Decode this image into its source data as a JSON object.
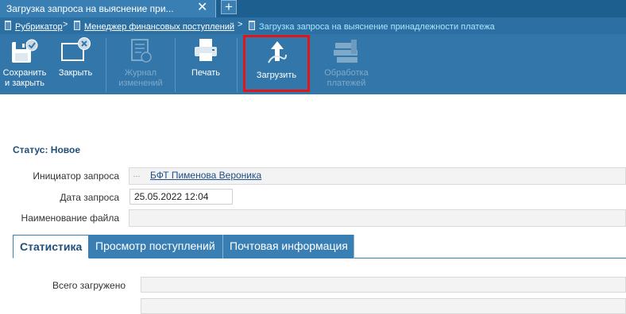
{
  "window_tab": {
    "title": "Загрузка запроса на выяснение при...",
    "close": "✕",
    "new_tab": "+"
  },
  "breadcrumb": [
    {
      "label": "Рубрикатор"
    },
    {
      "label": "Менеджер финансовых поступлений"
    },
    {
      "label": "Загрузка запроса на выяснение принадлежности платежа"
    }
  ],
  "breadcrumb_sep": ">",
  "toolbar": {
    "save_close": {
      "line1": "Сохранить",
      "line2": "и закрыть"
    },
    "close": "Закрыть",
    "journal": {
      "line1": "Журнал",
      "line2": "изменений"
    },
    "print": "Печать",
    "upload": "Загрузить",
    "process": {
      "line1": "Обработка",
      "line2": "платежей"
    }
  },
  "form": {
    "status": "Статус: Новое",
    "initiator_label": "Инициатор запроса",
    "initiator_value": "БФТ Пименова Вероника",
    "initiator_dots": "...",
    "date_label": "Дата запроса",
    "date_value": "25.05.2022 12:04",
    "filename_label": "Наименование файла",
    "filename_value": ""
  },
  "tabs": [
    {
      "label": "Статистика",
      "active": true
    },
    {
      "label": "Просмотр поступлений",
      "active": false
    },
    {
      "label": "Почтовая информация",
      "active": false
    }
  ],
  "stats": {
    "total_loaded_label": "Всего загружено",
    "total_loaded_value": ""
  },
  "colors": {
    "toolbar": "#3377aa",
    "tab_strip": "#1d5f8e",
    "highlight": "#e0161b",
    "link": "#1d4f86"
  },
  "icons": [
    "floppy-save-icon",
    "close-window-icon",
    "journal-icon",
    "printer-icon",
    "upload-icon",
    "process-payments-icon",
    "document-icon"
  ]
}
